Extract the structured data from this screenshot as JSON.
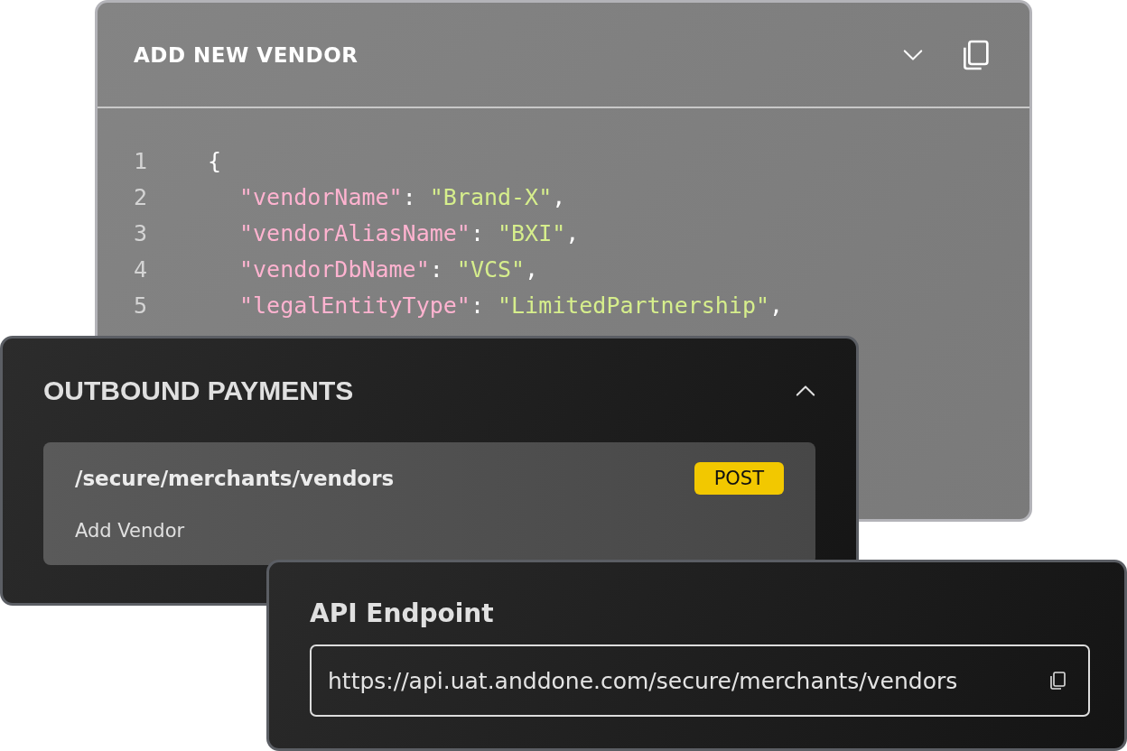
{
  "code_panel": {
    "title": "ADD NEW VENDOR",
    "expanded": false,
    "lines": [
      {
        "number": "1",
        "tokens": [
          {
            "kind": "punct",
            "text": "{"
          }
        ]
      },
      {
        "number": "2",
        "tokens": [
          {
            "kind": "key",
            "text": "\"vendorName\""
          },
          {
            "kind": "punct",
            "text": ": "
          },
          {
            "kind": "string",
            "text": "\"Brand-X\""
          },
          {
            "kind": "punct",
            "text": ","
          }
        ]
      },
      {
        "number": "3",
        "tokens": [
          {
            "kind": "key",
            "text": "\"vendorAliasName\""
          },
          {
            "kind": "punct",
            "text": ": "
          },
          {
            "kind": "string",
            "text": "\"BXI\""
          },
          {
            "kind": "punct",
            "text": ","
          }
        ]
      },
      {
        "number": "4",
        "tokens": [
          {
            "kind": "key",
            "text": "\"vendorDbName\""
          },
          {
            "kind": "punct",
            "text": ": "
          },
          {
            "kind": "string",
            "text": "\"VCS\""
          },
          {
            "kind": "punct",
            "text": ","
          }
        ]
      },
      {
        "number": "5",
        "tokens": [
          {
            "kind": "key",
            "text": "\"legalEntityType\""
          },
          {
            "kind": "punct",
            "text": ": "
          },
          {
            "kind": "string",
            "text": "\"LimitedPartnership\""
          },
          {
            "kind": "punct",
            "text": ","
          }
        ]
      }
    ]
  },
  "section": {
    "title": "OUTBOUND PAYMENTS",
    "expanded": true,
    "endpoint": {
      "path": "/secure/merchants/vendors",
      "method": "POST",
      "description": "Add Vendor"
    }
  },
  "api_endpoint": {
    "title": "API Endpoint",
    "value": "https://api.uat.anddone.com/secure/merchants/vendors"
  }
}
